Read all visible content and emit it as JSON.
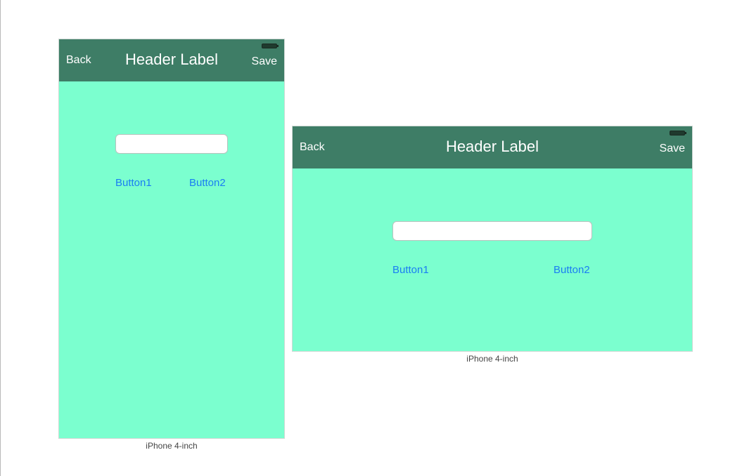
{
  "portrait": {
    "nav": {
      "back": "Back",
      "title": "Header Label",
      "save": "Save"
    },
    "text_field_value": "",
    "button1": "Button1",
    "button2": "Button2",
    "caption": "iPhone 4-inch"
  },
  "landscape": {
    "nav": {
      "back": "Back",
      "title": "Header Label",
      "save": "Save"
    },
    "text_field_value": "",
    "button1": "Button1",
    "button2": "Button2",
    "caption": "iPhone 4-inch"
  },
  "colors": {
    "navbar": "#3e7d66",
    "background": "#7bffcf",
    "button_text": "#1a7df3"
  },
  "icons": [
    "battery-icon"
  ]
}
